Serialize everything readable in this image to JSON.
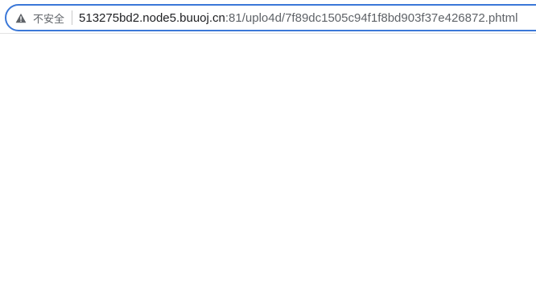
{
  "address_bar": {
    "security_label": "不安全",
    "security_icon": "warning-triangle-icon",
    "url_host": "513275bd2.node5.buuoj.cn",
    "url_rest": ":81/uplo4d/7f89dc1505c94f1f8bd903f37e426872.phtml",
    "focus_color": "#3b78d8"
  },
  "page": {
    "content": ""
  }
}
